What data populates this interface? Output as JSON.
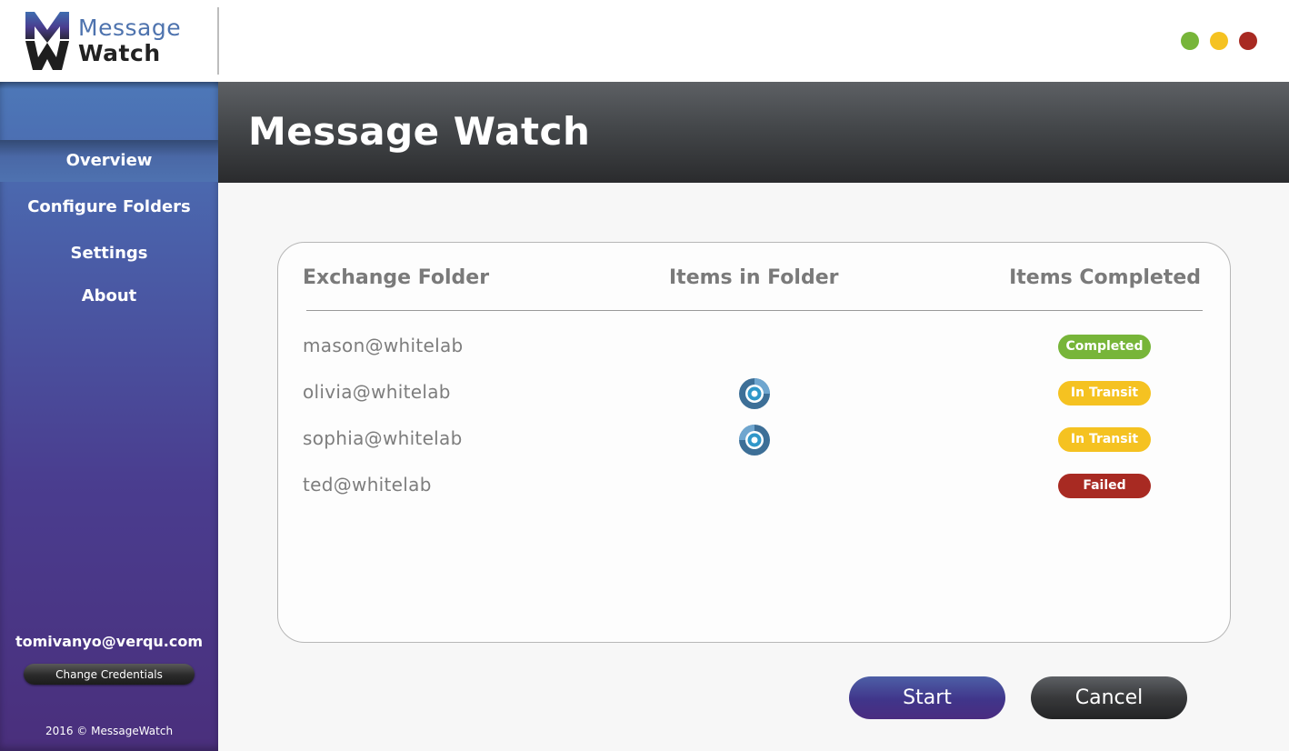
{
  "app": {
    "logo_line1": "Message",
    "logo_line2": "Watch",
    "window_controls": [
      {
        "name": "maximize-button",
        "color": "#77b539"
      },
      {
        "name": "minimize-button",
        "color": "#f5c221"
      },
      {
        "name": "close-button",
        "color": "#a82a22"
      }
    ]
  },
  "sidebar": {
    "items": [
      {
        "label": "Overview",
        "active": true
      },
      {
        "label": "Configure Folders",
        "active": false
      },
      {
        "label": "Settings",
        "active": false
      },
      {
        "label": "About",
        "active": false
      }
    ],
    "user_email": "tomivanyo@verqu.com",
    "change_credentials_label": "Change Credentials",
    "footer": "2016 © MessageWatch"
  },
  "header": {
    "title": "Message Watch"
  },
  "table": {
    "columns": [
      "Exchange Folder",
      "Items in Folder",
      "Items Completed"
    ],
    "rows": [
      {
        "folder": "mason@whitelab",
        "in_progress": false,
        "status": "Completed",
        "status_color": "#77b539"
      },
      {
        "folder": "olivia@whitelab",
        "in_progress": true,
        "status": "In Transit",
        "status_color": "#f5c221"
      },
      {
        "folder": "sophia@whitelab",
        "in_progress": true,
        "status": "In Transit",
        "status_color": "#f5c221"
      },
      {
        "folder": "ted@whitelab",
        "in_progress": false,
        "status": "Failed",
        "status_color": "#a82a22"
      }
    ]
  },
  "actions": {
    "start_label": "Start",
    "cancel_label": "Cancel"
  },
  "colors": {
    "brand_blue": "#4e73ae",
    "sidebar_purple": "#4a2f7c"
  }
}
